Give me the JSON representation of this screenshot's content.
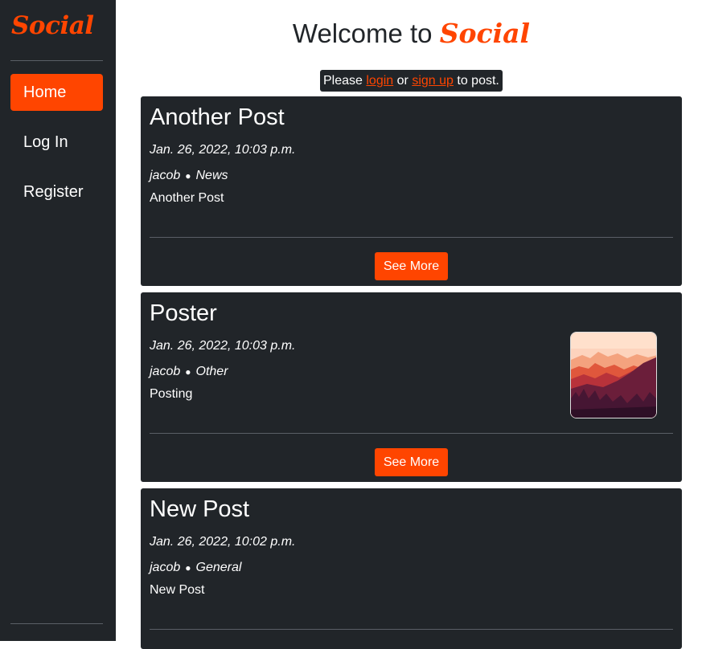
{
  "sidebar": {
    "brand": "Social",
    "items": [
      {
        "label": "Home",
        "active": true
      },
      {
        "label": "Log In"
      },
      {
        "label": "Register"
      }
    ]
  },
  "header": {
    "welcome_prefix": "Welcome to",
    "welcome_brand": "Social"
  },
  "notice": {
    "please": "Please",
    "login": "login",
    "or": "or",
    "signup": "sign up",
    "to_post": "to post."
  },
  "posts": [
    {
      "title": "Another Post",
      "date": "Jan. 26, 2022, 10:03 p.m.",
      "author": "jacob",
      "category": "News",
      "body": "Another Post",
      "button": "See More"
    },
    {
      "title": "Poster",
      "date": "Jan. 26, 2022, 10:03 p.m.",
      "author": "jacob",
      "category": "Other",
      "body": "Posting",
      "button": "See More",
      "image": "mountain-landscape"
    },
    {
      "title": "New Post",
      "date": "Jan. 26, 2022, 10:02 p.m.",
      "author": "jacob",
      "category": "General",
      "body": "New Post"
    }
  ],
  "colors": {
    "accent": "#ff4500",
    "dark": "#212529"
  }
}
